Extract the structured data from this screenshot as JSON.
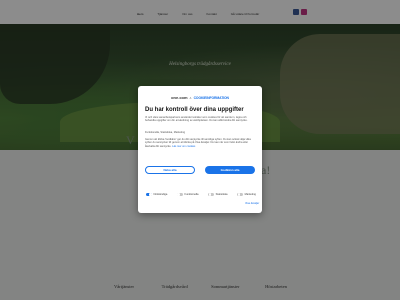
{
  "header": {
    "nav": [
      "Hem",
      "Tjänster",
      "Om oss",
      "Kontakt",
      "Gå vidare till formulär"
    ],
    "active_index": 0,
    "social": [
      {
        "icon": "facebook-icon",
        "color": "#3b5998"
      },
      {
        "icon": "instagram-icon",
        "color": "#c13584"
      }
    ]
  },
  "hero": {
    "title": "Helsingborgs trädgårdsservice"
  },
  "welcome": {
    "left": "V",
    "right": "a!"
  },
  "services": [
    "Vårtjänster",
    "Trädgårdsvård",
    "Sommartjänster",
    "Höstarbeten"
  ],
  "cookie_dialog": {
    "brand_onecom": "one.com",
    "brand_by": "&",
    "brand_ci": "COOKIEINFORMATION",
    "title": "Du har kontroll över dina uppgifter",
    "text_1": "Vi och våra samarbetspartners använder tekniker som cookies för att samla in, lagra och behandla uppgifter om din användning av webbplatsen. Du kan alltid ändra ditt samtycke.",
    "text_2": "Funktionella, Statistiska, Marketing",
    "text_3": "Genom att klicka 'Godkänn' ger du ditt samtycke till samtliga syften. Du kan också välja vilka syften du samtycker till genom att klicka på Visa detaljer. Du kan när som helst ändra eller återkalla ditt samtycke.",
    "link_text": "Läs mer om cookies",
    "reject_label": "Neka alla",
    "accept_label": "Godkänn alla",
    "toggles": [
      {
        "label": "Nödvändiga",
        "on": true
      },
      {
        "label": "Funktionella",
        "on": false
      },
      {
        "label": "Statistiska",
        "on": false
      },
      {
        "label": "Marketing",
        "on": false
      }
    ],
    "show_details": "Visa detaljer",
    "accent_color": "#1a73e8"
  }
}
